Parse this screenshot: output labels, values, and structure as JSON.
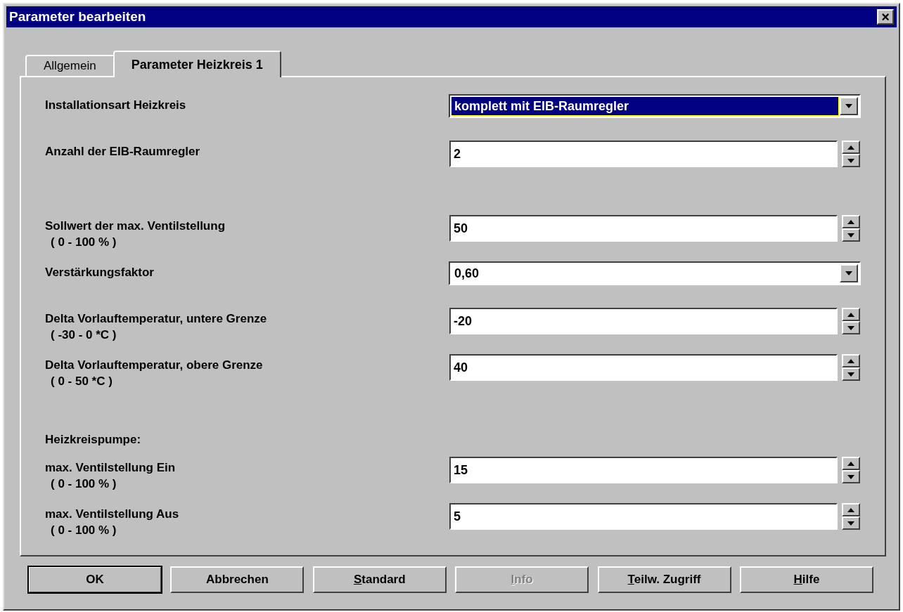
{
  "window": {
    "title": "Parameter bearbeiten",
    "close": "×"
  },
  "tabs": [
    {
      "label": "Allgemein",
      "selected": false
    },
    {
      "label": "Parameter Heizkreis 1",
      "selected": true
    }
  ],
  "groups": [
    {
      "rows": [
        {
          "kind": "dropdown",
          "label": "Installationsart Heizkreis",
          "value": "komplett mit EIB-Raumregler",
          "focused": true
        },
        {
          "kind": "spin",
          "label": "Anzahl der EIB-Raumregler",
          "value": "2"
        }
      ]
    },
    {
      "rows": [
        {
          "kind": "spin",
          "label": "Sollwert der max. Ventilstellung",
          "range": "( 0 - 100 % )",
          "value": "50"
        },
        {
          "kind": "dropdown",
          "label": "Verstärkungsfaktor",
          "value": "0,60",
          "focused": false
        },
        {
          "kind": "spin",
          "label": "Delta Vorlauftemperatur, untere Grenze",
          "range": "( -30 - 0 *C )",
          "value": "-20"
        },
        {
          "kind": "spin",
          "label": "Delta Vorlauftemperatur, obere Grenze",
          "range": "( 0 - 50 *C )",
          "value": "40"
        }
      ]
    },
    {
      "rows": [
        {
          "kind": "heading",
          "label": "Heizkreispumpe:"
        },
        {
          "kind": "spin",
          "label": "max. Ventilstellung Ein",
          "range": "( 0 - 100 % )",
          "value": "15"
        },
        {
          "kind": "spin",
          "label": "max. Ventilstellung Aus",
          "range": "( 0 - 100 % )",
          "value": "5"
        }
      ]
    }
  ],
  "buttons": [
    {
      "label_parts": [
        "OK"
      ],
      "default": true,
      "disabled": false
    },
    {
      "label_parts": [
        "Abbrechen"
      ],
      "default": false,
      "disabled": false
    },
    {
      "label_parts": [
        "S",
        "tandard"
      ],
      "default": false,
      "disabled": false
    },
    {
      "label_parts": [
        "I",
        "nfo"
      ],
      "default": false,
      "disabled": true
    },
    {
      "label_parts": [
        "T",
        "eilw. Zugriff"
      ],
      "default": false,
      "disabled": false
    },
    {
      "label_parts": [
        "H",
        "ilfe"
      ],
      "default": false,
      "disabled": false
    }
  ]
}
